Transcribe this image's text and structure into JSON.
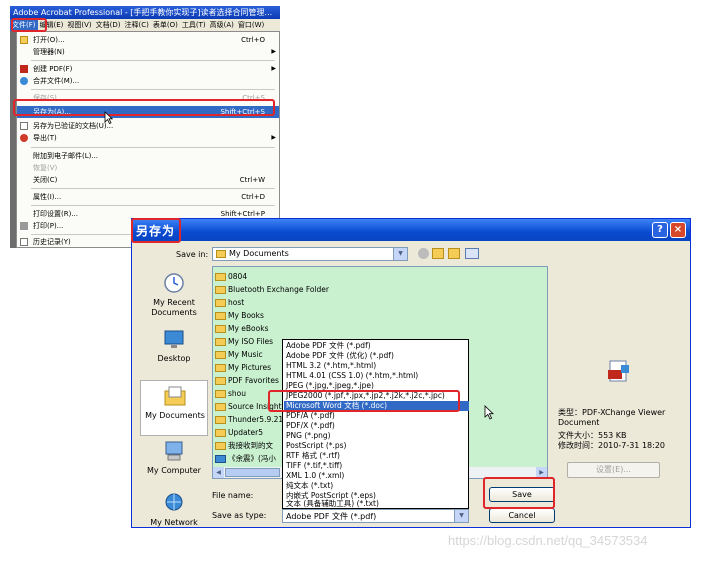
{
  "acrobat": {
    "title": "Adobe Acrobat Professional - [手把手教你实现子]读者选择合同管理...",
    "menubar": [
      "文件(F)",
      "编辑(E)",
      "视图(V)",
      "文档(D)",
      "注释(C)",
      "表单(O)",
      "工具(T)",
      "高级(A)",
      "窗口(W)"
    ],
    "file_menu": {
      "open": {
        "label": "打开(O)...",
        "shortcut": "Ctrl+O"
      },
      "organizer": {
        "label": "管理器(N)"
      },
      "create_pdf": {
        "label": "创建 PDF(F)"
      },
      "combine": {
        "label": "合并文件(M)..."
      },
      "save": {
        "label": "保存(S)",
        "shortcut": "Ctrl+S"
      },
      "save_as": {
        "label": "另存为(A)...",
        "shortcut": "Shift+Ctrl+S"
      },
      "save_certified": {
        "label": "另存为已验证的文档(U)..."
      },
      "export": {
        "label": "导出(T)"
      },
      "attach_email": {
        "label": "附加到电子邮件(L)..."
      },
      "revert": {
        "label": "恢复(V)"
      },
      "close": {
        "label": "关闭(C)",
        "shortcut": "Ctrl+W"
      },
      "properties": {
        "label": "属性(I)...",
        "shortcut": "Ctrl+D"
      },
      "print_setup": {
        "label": "打印设置(R)...",
        "shortcut": "Shift+Ctrl+P"
      },
      "print": {
        "label": "打印(P)..."
      },
      "history": {
        "label": "历史记录(Y)"
      }
    }
  },
  "dialog": {
    "title": "另存为",
    "help": "?",
    "close": "×",
    "save_in_label": "Save in:",
    "save_in_value": "My Documents",
    "places": [
      "My Recent Documents",
      "Desktop",
      "My Documents",
      "My Computer",
      "My Network"
    ],
    "files": [
      "0804",
      "Bluetooth Exchange Folder",
      "host",
      "My Books",
      "My eBooks",
      "My ISO Files",
      "My Music",
      "My Pictures",
      "PDF Favorites",
      "shou",
      "Source Insight",
      "Thunder5.9.21",
      "Updater5",
      "我接收到的文",
      "《余震》(冯小"
    ],
    "file_types": [
      "Adobe PDF 文件 (*.pdf)",
      "Adobe PDF 文件 (优化) (*.pdf)",
      "HTML 3.2 (*.htm,*.html)",
      "HTML 4.01 (CSS 1.0) (*.htm,*.html)",
      "JPEG (*.jpg,*.jpeg,*.jpe)",
      "JPEG2000 (*.jpf,*.jpx,*.jp2,*.j2k,*.j2c,*.jpc)",
      "Microsoft Word 文档 (*.doc)",
      "PDF/A (*.pdf)",
      "PDF/X (*.pdf)",
      "PNG (*.png)",
      "PostScript (*.ps)",
      "RTF 格式 (*.rtf)",
      "TIFF (*.tif,*.tiff)",
      "XML 1.0 (*.xml)",
      "纯文本 (*.txt)",
      "内嵌式 PostScript (*.eps)",
      "文本 (具备辅助工具) (*.txt)"
    ],
    "selected_type_index": 6,
    "preview": {
      "type": "类型：PDF-XChange Viewer Document",
      "size": "文件大小：553 KB",
      "date": "修改时间：2010-7-31 18:20",
      "settings": "设置(E)..."
    },
    "file_name_label": "File name:",
    "save_as_type_label": "Save as type:",
    "save_as_type_value": "Adobe PDF 文件 (*.pdf)",
    "save_button": "Save",
    "cancel_button": "Cancel"
  },
  "watermark": "https://blog.csdn.net/qq_34573534",
  "colors": {
    "highlight": "#e0252b",
    "selection": "#316ac5",
    "file_list_bg": "#c9f0cf"
  }
}
